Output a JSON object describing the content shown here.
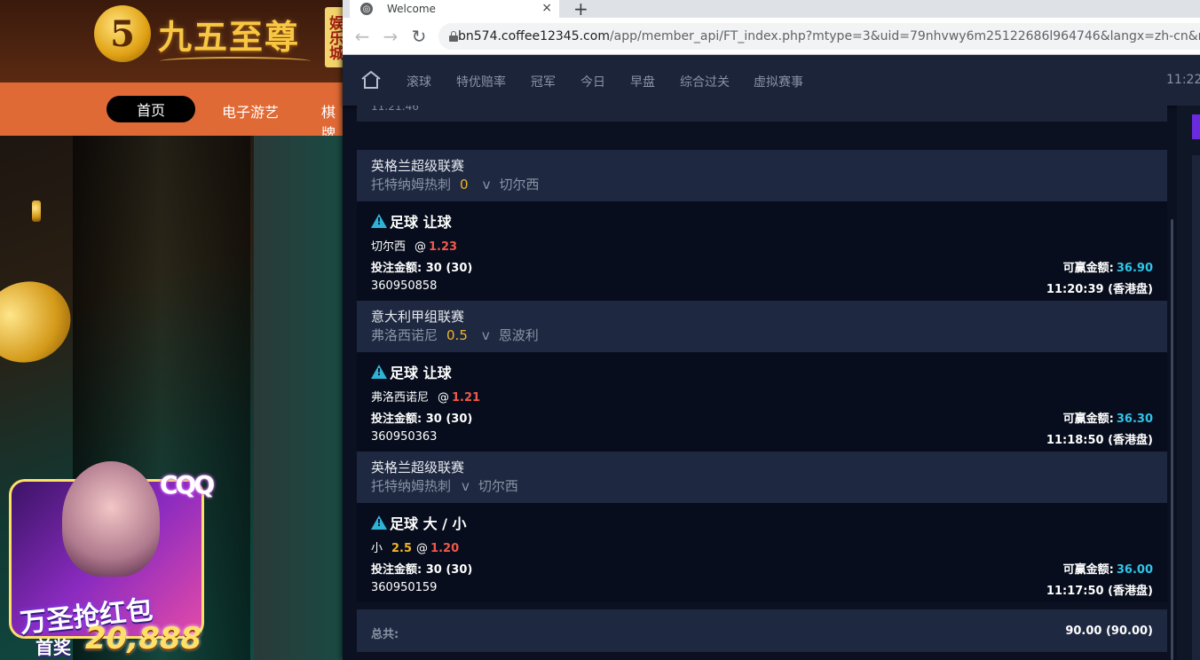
{
  "background_site": {
    "logo_glyph": "5",
    "logo_text": "九五至尊",
    "logo_tag": "娱乐城",
    "nav": [
      "首页",
      "电子游艺",
      "棋牌"
    ],
    "promo": {
      "badge": "CQQ",
      "title": "万圣抢红包",
      "prize_label": "首奖",
      "prize_value": "20,888"
    }
  },
  "browser": {
    "tab_title": "Welcome",
    "tab_close": "×",
    "new_tab": "+",
    "url_domain": "bn574.coffee12345.com",
    "url_path": "/app/member_api/FT_index.php?mtype=3&uid=79nhvwy6m25122686l964746&langx=zh-cn&news"
  },
  "app": {
    "nav": [
      "滚球",
      "特优赔率",
      "冠军",
      "今日",
      "早盘",
      "综合过关",
      "虚拟赛事"
    ],
    "time": "11:22",
    "prev_strip_text": "11:21:46",
    "tickets": [
      {
        "league": "英格兰超级联赛",
        "home": "托特纳姆热刺",
        "handicap": "0",
        "vs": "v",
        "away": "切尔西",
        "bet_type": "足球 让球",
        "pick": "切尔西",
        "pick_line": "",
        "at": "@",
        "odds": "1.23",
        "stake_label": "投注金额:",
        "stake": "30 (30)",
        "win_label": "可赢金额:",
        "win": "36.90",
        "ticket_id": "360950858",
        "time": "11:20:39 (香港盘)"
      },
      {
        "league": "意大利甲组联赛",
        "home": "弗洛西诺尼",
        "handicap": "0.5",
        "vs": "v",
        "away": "恩波利",
        "bet_type": "足球 让球",
        "pick": "弗洛西诺尼",
        "pick_line": "",
        "at": "@",
        "odds": "1.21",
        "stake_label": "投注金额:",
        "stake": "30 (30)",
        "win_label": "可赢金额:",
        "win": "36.30",
        "ticket_id": "360950363",
        "time": "11:18:50 (香港盘)"
      },
      {
        "league": "英格兰超级联赛",
        "home": "托特纳姆热刺",
        "handicap": "",
        "vs": "v",
        "away": "切尔西",
        "bet_type": "足球 大 / 小",
        "pick": "小",
        "pick_line": "2.5",
        "at": "@",
        "odds": "1.20",
        "stake_label": "投注金额:",
        "stake": "30 (30)",
        "win_label": "可赢金额:",
        "win": "36.00",
        "ticket_id": "360950159",
        "time": "11:17:50 (香港盘)"
      }
    ],
    "total_label": "总共:",
    "total_value": "90.00 (90.00)"
  },
  "colors": {
    "accent_odds": "#f0584a",
    "accent_handicap": "#f0b429",
    "accent_win": "#2fc4e8",
    "panel_bg": "#1e2840",
    "body_bg": "#070d1c"
  }
}
